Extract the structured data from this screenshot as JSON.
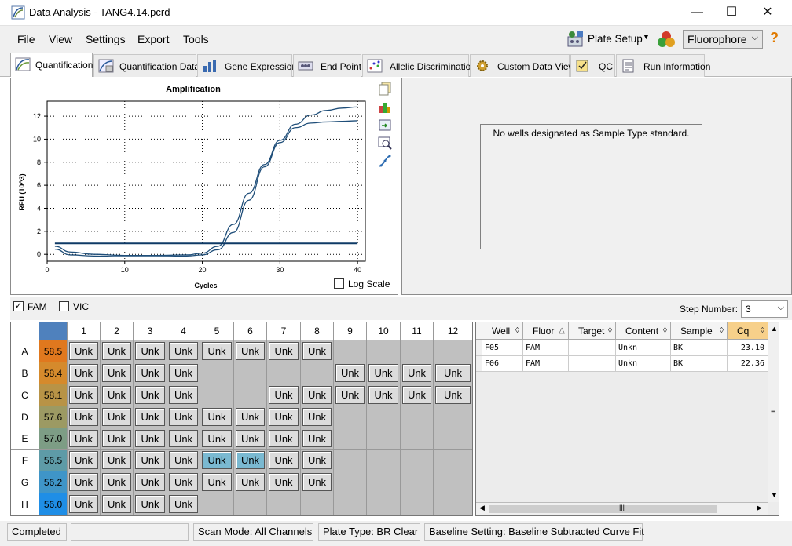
{
  "window": {
    "title": "Data Analysis - TANG4.14.pcrd",
    "minimize": "—",
    "maximize": "☐",
    "close": "✕"
  },
  "menu": {
    "file": "File",
    "view": "View",
    "settings": "Settings",
    "export": "Export",
    "tools": "Tools",
    "plate_setup": "Plate Setup",
    "fluorophore": "Fluorophore",
    "help": "?"
  },
  "tabs": [
    {
      "label": "Quantification"
    },
    {
      "label": "Quantification Data"
    },
    {
      "label": "Gene Expression"
    },
    {
      "label": "End Point"
    },
    {
      "label": "Allelic Discrimination"
    },
    {
      "label": "Custom Data View"
    },
    {
      "label": "QC"
    },
    {
      "label": "Run Information"
    }
  ],
  "right_panel": {
    "message": "No wells designated as Sample Type standard."
  },
  "log_scale": {
    "label": "Log Scale",
    "checked": false
  },
  "chart_data": {
    "type": "line",
    "title": "Amplification",
    "xlabel": "Cycles",
    "ylabel": "RFU (10^3)",
    "xlim": [
      0,
      41
    ],
    "ylim": [
      -0.6,
      13.3
    ],
    "xticks": [
      0,
      10,
      20,
      30,
      40
    ],
    "yticks": [
      0,
      2,
      4,
      6,
      8,
      10,
      12
    ],
    "grid": true,
    "threshold": 0.95,
    "series": [
      {
        "x": [
          1,
          3,
          6,
          10,
          14,
          18,
          20,
          22,
          24,
          26,
          28,
          30,
          32,
          34,
          36,
          38,
          40
        ],
        "values": [
          0.45,
          -0.05,
          -0.15,
          -0.2,
          -0.2,
          -0.15,
          -0.05,
          0.4,
          1.9,
          4.7,
          7.6,
          9.7,
          11.0,
          11.4,
          11.5,
          11.55,
          11.6
        ]
      },
      {
        "x": [
          1,
          3,
          6,
          10,
          14,
          18,
          20,
          22,
          24,
          26,
          28,
          30,
          32,
          34,
          36,
          38,
          40
        ],
        "values": [
          0.7,
          0.2,
          0.0,
          -0.1,
          -0.1,
          -0.05,
          0.1,
          0.7,
          2.6,
          5.3,
          7.8,
          9.9,
          11.3,
          12.1,
          12.5,
          12.7,
          12.8
        ]
      }
    ]
  },
  "filters": {
    "fam": {
      "label": "FAM",
      "checked": true
    },
    "vic": {
      "label": "VIC",
      "checked": false
    },
    "step_label": "Step Number:",
    "step_value": "3"
  },
  "plate": {
    "columns": [
      "1",
      "2",
      "3",
      "4",
      "5",
      "6",
      "7",
      "8",
      "9",
      "10",
      "11",
      "12"
    ],
    "rows": [
      {
        "label": "A",
        "temp": "58.5",
        "color": "#e0781e",
        "wells": [
          "Unk",
          "Unk",
          "Unk",
          "Unk",
          "Unk",
          "Unk",
          "Unk",
          "Unk",
          "",
          "",
          "",
          ""
        ]
      },
      {
        "label": "B",
        "temp": "58.4",
        "color": "#d58a2c",
        "wells": [
          "Unk",
          "Unk",
          "Unk",
          "Unk",
          "",
          "",
          "",
          "",
          "Unk",
          "Unk",
          "Unk",
          "Unk"
        ]
      },
      {
        "label": "C",
        "temp": "58.1",
        "color": "#b89346",
        "wells": [
          "Unk",
          "Unk",
          "Unk",
          "Unk",
          "",
          "",
          "Unk",
          "Unk",
          "Unk",
          "Unk",
          "Unk",
          "Unk"
        ]
      },
      {
        "label": "D",
        "temp": "57.6",
        "color": "#9c9a63",
        "wells": [
          "Unk",
          "Unk",
          "Unk",
          "Unk",
          "Unk",
          "Unk",
          "Unk",
          "Unk",
          "",
          "",
          "",
          ""
        ]
      },
      {
        "label": "E",
        "temp": "57.0",
        "color": "#7d9d85",
        "wells": [
          "Unk",
          "Unk",
          "Unk",
          "Unk",
          "Unk",
          "Unk",
          "Unk",
          "Unk",
          "",
          "",
          "",
          ""
        ]
      },
      {
        "label": "F",
        "temp": "56.5",
        "color": "#5e9ba7",
        "wells": [
          "Unk",
          "Unk",
          "Unk",
          "Unk",
          "Unk*",
          "Unk*",
          "Unk",
          "Unk",
          "",
          "",
          "",
          ""
        ]
      },
      {
        "label": "G",
        "temp": "56.2",
        "color": "#3f95c8",
        "wells": [
          "Unk",
          "Unk",
          "Unk",
          "Unk",
          "Unk",
          "Unk",
          "Unk",
          "Unk",
          "",
          "",
          "",
          ""
        ]
      },
      {
        "label": "H",
        "temp": "56.0",
        "color": "#1f8ee6",
        "wells": [
          "Unk",
          "Unk",
          "Unk",
          "Unk",
          "",
          "",
          "",
          "",
          "",
          "",
          "",
          ""
        ]
      }
    ]
  },
  "results": {
    "headers": [
      "Well",
      "Fluor",
      "Target",
      "Content",
      "Sample",
      "Cq"
    ],
    "rows": [
      [
        "F05",
        "FAM",
        "",
        "Unkn",
        "BK",
        "23.10"
      ],
      [
        "F06",
        "FAM",
        "",
        "Unkn",
        "BK",
        "22.36"
      ]
    ]
  },
  "status": {
    "state": "Completed",
    "scan_mode": "Scan Mode: All Channels",
    "plate_type": "Plate Type: BR Clear",
    "baseline": "Baseline Setting: Baseline Subtracted Curve Fit"
  }
}
